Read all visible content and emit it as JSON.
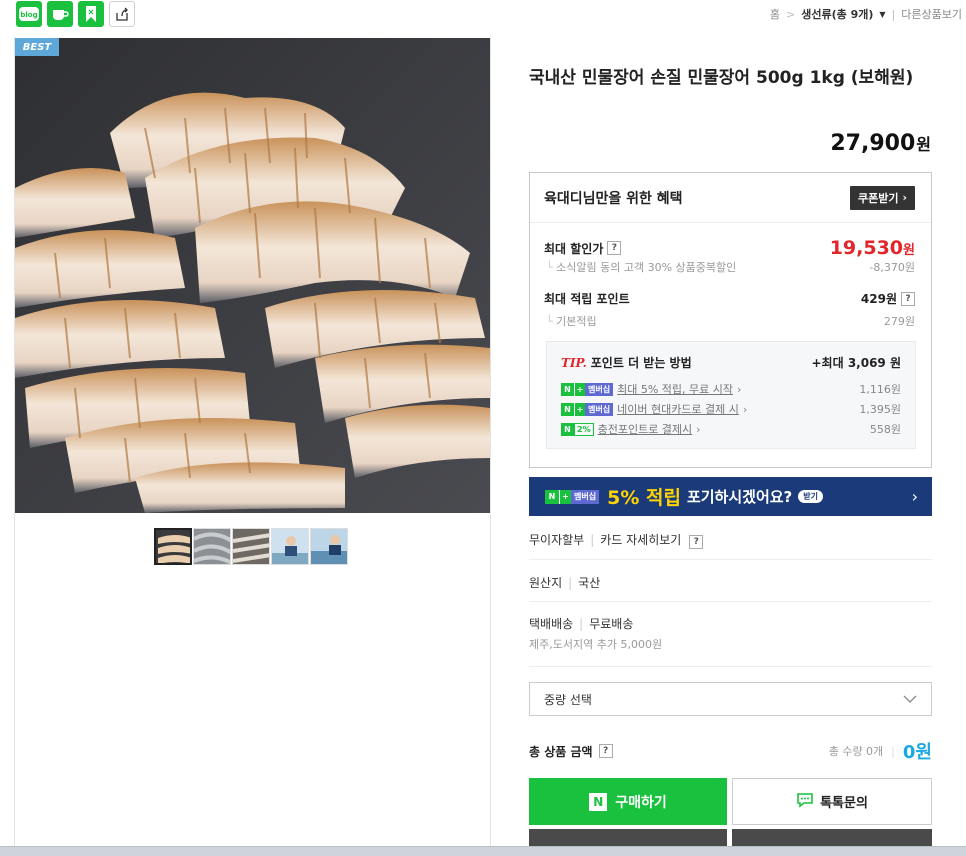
{
  "breadcrumb": {
    "home": "홈",
    "category": "생선류(총 9개)",
    "other": "다른상품보기"
  },
  "share_icons": [
    "blog-icon",
    "cafe-icon",
    "kakaostory-icon",
    "share-icon"
  ],
  "share": {
    "blog_label": "blog"
  },
  "gallery": {
    "badge": "BEST",
    "thumbnail_count": 5,
    "active_thumbnail": 1
  },
  "product": {
    "title": "국내산 민물장어 손질 민물장어 500g 1kg (보해원)",
    "price": "27,900",
    "price_unit": "원"
  },
  "benefit": {
    "title": "육대디님만을 위한 혜택",
    "coupon_button": "쿠폰받기",
    "max_discount_label": "최대 할인가",
    "max_discount_price": "19,530",
    "max_discount_unit": "원",
    "discount_note": "소식알림 동의 고객 30% 상품중복할인",
    "discount_amount": "-8,370원",
    "max_point_label": "최대 적립 포인트",
    "max_point_value": "429원",
    "basic_point_label": "기본적립",
    "basic_point_value": "279원",
    "tip": {
      "tip_word": "TIP.",
      "title": "포인트 더 받는 방법",
      "max": "+최대 3,069 원",
      "rows": [
        {
          "badge": "멤버십",
          "text": "최대 5% 적립, 무료 시작",
          "value": "1,116원"
        },
        {
          "badge": "멤버십",
          "text": "네이버 현대카드로 결제 시",
          "value": "1,395원"
        },
        {
          "badge": "2%",
          "text": "충전포인트로 결제시",
          "value": "558원"
        }
      ]
    }
  },
  "banner": {
    "badge": "멤버십",
    "percent": "5% 적립",
    "text": "포기하시겠어요?",
    "pill": "받기"
  },
  "details": {
    "installment": "무이자할부",
    "card_detail": "카드 자세히보기",
    "origin_label": "원산지",
    "origin_value": "국산",
    "delivery_label": "택배배송",
    "delivery_value": "무료배송",
    "delivery_note": "제주,도서지역 추가 5,000원"
  },
  "option": {
    "select_label": "중량 선택"
  },
  "total": {
    "label": "총 상품 금액",
    "qty": "총 수량 0개",
    "amount": "0원"
  },
  "buttons": {
    "buy": "구매하기",
    "talk": "톡톡문의"
  },
  "colors": {
    "naver_green": "#19c13e",
    "sale_red": "#e1262b",
    "banner_navy": "#1b3a7a",
    "total_blue": "#1aa9e5"
  }
}
